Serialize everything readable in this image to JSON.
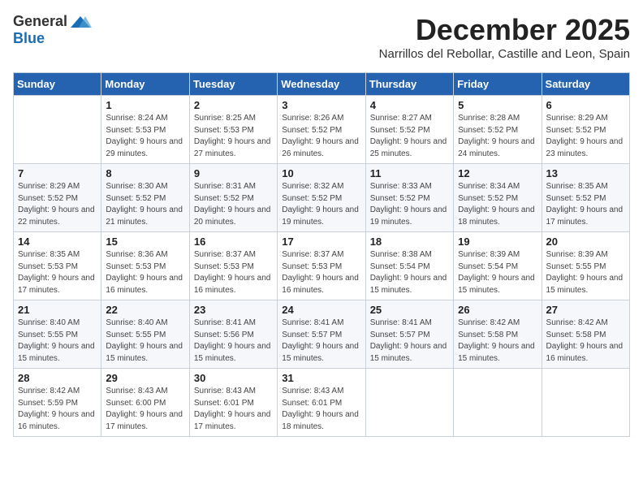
{
  "logo": {
    "general": "General",
    "blue": "Blue"
  },
  "header": {
    "month": "December 2025",
    "location": "Narrillos del Rebollar, Castille and Leon, Spain"
  },
  "days_of_week": [
    "Sunday",
    "Monday",
    "Tuesday",
    "Wednesday",
    "Thursday",
    "Friday",
    "Saturday"
  ],
  "weeks": [
    [
      {
        "day": "",
        "sunrise": "",
        "sunset": "",
        "daylight": ""
      },
      {
        "day": "1",
        "sunrise": "Sunrise: 8:24 AM",
        "sunset": "Sunset: 5:53 PM",
        "daylight": "Daylight: 9 hours and 29 minutes."
      },
      {
        "day": "2",
        "sunrise": "Sunrise: 8:25 AM",
        "sunset": "Sunset: 5:53 PM",
        "daylight": "Daylight: 9 hours and 27 minutes."
      },
      {
        "day": "3",
        "sunrise": "Sunrise: 8:26 AM",
        "sunset": "Sunset: 5:52 PM",
        "daylight": "Daylight: 9 hours and 26 minutes."
      },
      {
        "day": "4",
        "sunrise": "Sunrise: 8:27 AM",
        "sunset": "Sunset: 5:52 PM",
        "daylight": "Daylight: 9 hours and 25 minutes."
      },
      {
        "day": "5",
        "sunrise": "Sunrise: 8:28 AM",
        "sunset": "Sunset: 5:52 PM",
        "daylight": "Daylight: 9 hours and 24 minutes."
      },
      {
        "day": "6",
        "sunrise": "Sunrise: 8:29 AM",
        "sunset": "Sunset: 5:52 PM",
        "daylight": "Daylight: 9 hours and 23 minutes."
      }
    ],
    [
      {
        "day": "7",
        "sunrise": "Sunrise: 8:29 AM",
        "sunset": "Sunset: 5:52 PM",
        "daylight": "Daylight: 9 hours and 22 minutes."
      },
      {
        "day": "8",
        "sunrise": "Sunrise: 8:30 AM",
        "sunset": "Sunset: 5:52 PM",
        "daylight": "Daylight: 9 hours and 21 minutes."
      },
      {
        "day": "9",
        "sunrise": "Sunrise: 8:31 AM",
        "sunset": "Sunset: 5:52 PM",
        "daylight": "Daylight: 9 hours and 20 minutes."
      },
      {
        "day": "10",
        "sunrise": "Sunrise: 8:32 AM",
        "sunset": "Sunset: 5:52 PM",
        "daylight": "Daylight: 9 hours and 19 minutes."
      },
      {
        "day": "11",
        "sunrise": "Sunrise: 8:33 AM",
        "sunset": "Sunset: 5:52 PM",
        "daylight": "Daylight: 9 hours and 19 minutes."
      },
      {
        "day": "12",
        "sunrise": "Sunrise: 8:34 AM",
        "sunset": "Sunset: 5:52 PM",
        "daylight": "Daylight: 9 hours and 18 minutes."
      },
      {
        "day": "13",
        "sunrise": "Sunrise: 8:35 AM",
        "sunset": "Sunset: 5:52 PM",
        "daylight": "Daylight: 9 hours and 17 minutes."
      }
    ],
    [
      {
        "day": "14",
        "sunrise": "Sunrise: 8:35 AM",
        "sunset": "Sunset: 5:53 PM",
        "daylight": "Daylight: 9 hours and 17 minutes."
      },
      {
        "day": "15",
        "sunrise": "Sunrise: 8:36 AM",
        "sunset": "Sunset: 5:53 PM",
        "daylight": "Daylight: 9 hours and 16 minutes."
      },
      {
        "day": "16",
        "sunrise": "Sunrise: 8:37 AM",
        "sunset": "Sunset: 5:53 PM",
        "daylight": "Daylight: 9 hours and 16 minutes."
      },
      {
        "day": "17",
        "sunrise": "Sunrise: 8:37 AM",
        "sunset": "Sunset: 5:53 PM",
        "daylight": "Daylight: 9 hours and 16 minutes."
      },
      {
        "day": "18",
        "sunrise": "Sunrise: 8:38 AM",
        "sunset": "Sunset: 5:54 PM",
        "daylight": "Daylight: 9 hours and 15 minutes."
      },
      {
        "day": "19",
        "sunrise": "Sunrise: 8:39 AM",
        "sunset": "Sunset: 5:54 PM",
        "daylight": "Daylight: 9 hours and 15 minutes."
      },
      {
        "day": "20",
        "sunrise": "Sunrise: 8:39 AM",
        "sunset": "Sunset: 5:55 PM",
        "daylight": "Daylight: 9 hours and 15 minutes."
      }
    ],
    [
      {
        "day": "21",
        "sunrise": "Sunrise: 8:40 AM",
        "sunset": "Sunset: 5:55 PM",
        "daylight": "Daylight: 9 hours and 15 minutes."
      },
      {
        "day": "22",
        "sunrise": "Sunrise: 8:40 AM",
        "sunset": "Sunset: 5:55 PM",
        "daylight": "Daylight: 9 hours and 15 minutes."
      },
      {
        "day": "23",
        "sunrise": "Sunrise: 8:41 AM",
        "sunset": "Sunset: 5:56 PM",
        "daylight": "Daylight: 9 hours and 15 minutes."
      },
      {
        "day": "24",
        "sunrise": "Sunrise: 8:41 AM",
        "sunset": "Sunset: 5:57 PM",
        "daylight": "Daylight: 9 hours and 15 minutes."
      },
      {
        "day": "25",
        "sunrise": "Sunrise: 8:41 AM",
        "sunset": "Sunset: 5:57 PM",
        "daylight": "Daylight: 9 hours and 15 minutes."
      },
      {
        "day": "26",
        "sunrise": "Sunrise: 8:42 AM",
        "sunset": "Sunset: 5:58 PM",
        "daylight": "Daylight: 9 hours and 15 minutes."
      },
      {
        "day": "27",
        "sunrise": "Sunrise: 8:42 AM",
        "sunset": "Sunset: 5:58 PM",
        "daylight": "Daylight: 9 hours and 16 minutes."
      }
    ],
    [
      {
        "day": "28",
        "sunrise": "Sunrise: 8:42 AM",
        "sunset": "Sunset: 5:59 PM",
        "daylight": "Daylight: 9 hours and 16 minutes."
      },
      {
        "day": "29",
        "sunrise": "Sunrise: 8:43 AM",
        "sunset": "Sunset: 6:00 PM",
        "daylight": "Daylight: 9 hours and 17 minutes."
      },
      {
        "day": "30",
        "sunrise": "Sunrise: 8:43 AM",
        "sunset": "Sunset: 6:01 PM",
        "daylight": "Daylight: 9 hours and 17 minutes."
      },
      {
        "day": "31",
        "sunrise": "Sunrise: 8:43 AM",
        "sunset": "Sunset: 6:01 PM",
        "daylight": "Daylight: 9 hours and 18 minutes."
      },
      {
        "day": "",
        "sunrise": "",
        "sunset": "",
        "daylight": ""
      },
      {
        "day": "",
        "sunrise": "",
        "sunset": "",
        "daylight": ""
      },
      {
        "day": "",
        "sunrise": "",
        "sunset": "",
        "daylight": ""
      }
    ]
  ]
}
